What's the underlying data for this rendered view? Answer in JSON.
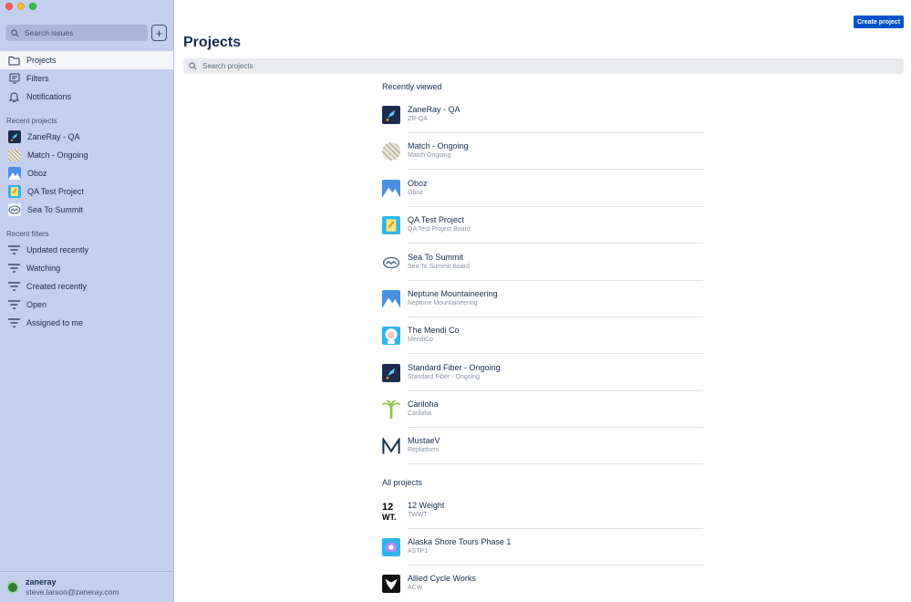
{
  "sidebar": {
    "search_placeholder": "Search issues",
    "add_label": "+",
    "nav": [
      {
        "label": "Projects",
        "icon": "folder-icon"
      },
      {
        "label": "Filters",
        "icon": "filter-board-icon"
      },
      {
        "label": "Notifications",
        "icon": "bell-icon"
      }
    ],
    "recent_projects_label": "Recent projects",
    "recent_projects": [
      {
        "label": "ZaneRay - QA"
      },
      {
        "label": "Match - Ongoing"
      },
      {
        "label": "Oboz"
      },
      {
        "label": "QA Test Project"
      },
      {
        "label": "Sea To Summit"
      }
    ],
    "recent_filters_label": "Recent filters",
    "recent_filters": [
      {
        "label": "Updated recently"
      },
      {
        "label": "Watching"
      },
      {
        "label": "Created recently"
      },
      {
        "label": "Open"
      },
      {
        "label": "Assigned to me"
      }
    ],
    "user": {
      "name": "zaneray",
      "email": "steve.larson@zaneray.com"
    }
  },
  "main": {
    "create_button": "Create project",
    "title": "Projects",
    "search_placeholder": "Search projects",
    "recently_viewed_label": "Recently viewed",
    "recently_viewed": [
      {
        "name": "ZaneRay - QA",
        "key": "ZR-QA"
      },
      {
        "name": "Match - Ongoing",
        "key": "Match Ongoing"
      },
      {
        "name": "Oboz",
        "key": "Oboz"
      },
      {
        "name": "QA Test Project",
        "key": "QA Test Project Board"
      },
      {
        "name": "Sea To Summit",
        "key": "Sea To Summit Board"
      },
      {
        "name": "Neptune Mountaineering",
        "key": "Neptune Mountaineering"
      },
      {
        "name": "The Mendi Co",
        "key": "MendiCo"
      },
      {
        "name": "Standard Fiber - Ongoing",
        "key": "Standard Fiber - Ongoing"
      },
      {
        "name": "Cariloha",
        "key": "Cariloha"
      },
      {
        "name": "MustaeV",
        "key": "Replatform"
      }
    ],
    "all_projects_label": "All projects",
    "all_projects": [
      {
        "name": "12 Weight",
        "key": "TWWT"
      },
      {
        "name": "Alaska Shore Tours Phase 1",
        "key": "ASTP1"
      },
      {
        "name": "Allied Cycle Works",
        "key": "ACW"
      }
    ]
  },
  "colors": {
    "sidebar_bg": "#c4cff0",
    "accent": "#0052cc",
    "text": "#172b4d"
  }
}
